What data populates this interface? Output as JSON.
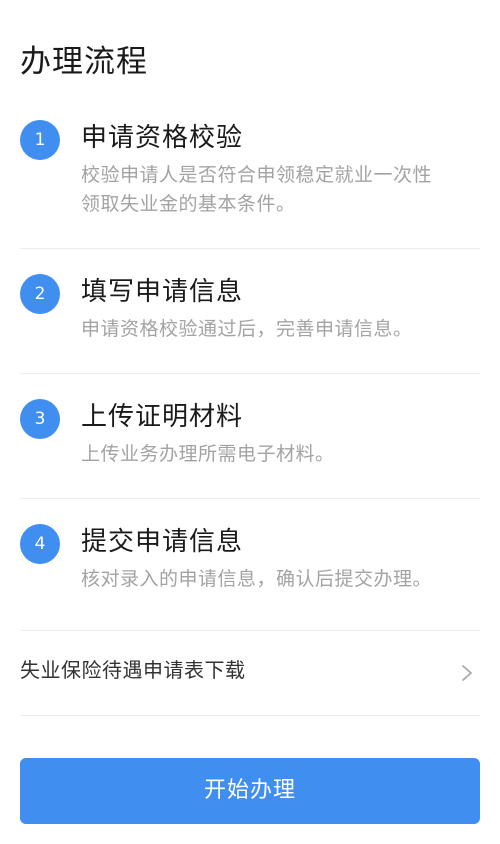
{
  "page": {
    "title": "办理流程"
  },
  "steps": [
    {
      "number": "1",
      "title": "申请资格校验",
      "desc_line1": "校验申请人是否符合申领稳定就业一次性",
      "desc_line2": "领取失业金的基本条件。"
    },
    {
      "number": "2",
      "title": "填写申请信息",
      "desc_line1": "申请资格校验通过后，完善申请信息。"
    },
    {
      "number": "3",
      "title": "上传证明材料",
      "desc_line1": "上传业务办理所需电子材料。"
    },
    {
      "number": "4",
      "title": "提交申请信息",
      "desc_line1": "核对录入的申请信息，确认后提交办理。"
    }
  ],
  "download": {
    "label": "失业保险待遇申请表下载",
    "icon": "chevron-right-icon"
  },
  "start_button": {
    "label": "开始办理"
  },
  "colors": {
    "accent": "#3f8ef0",
    "title_text": "#1a1a1a",
    "desc_text": "#a3a3a3",
    "divider": "#ececec"
  }
}
